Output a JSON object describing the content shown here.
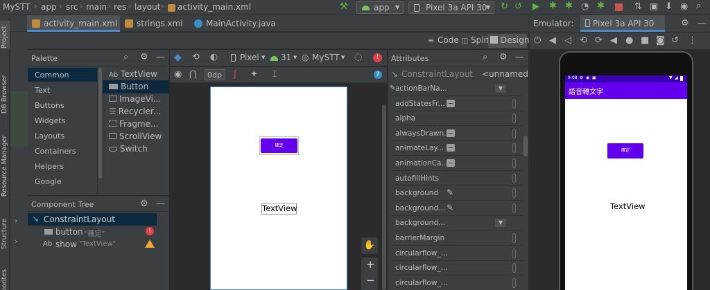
{
  "breadcrumb": {
    "items": [
      "MySTT",
      "app",
      "src",
      "main",
      "res",
      "layout",
      "activity_main.xml"
    ]
  },
  "toolbar": {
    "run_config": "app",
    "device": "Pixel 3a API 30"
  },
  "editor_tabs": [
    {
      "label": "activity_main.xml"
    },
    {
      "label": "strings.xml"
    },
    {
      "label": "MainActivity.java"
    }
  ],
  "emulator": {
    "label": "Emulator:",
    "device_tab": "Pixel 3a API 30",
    "status_time": "9:08",
    "app_title": "語音轉文字",
    "button_text": "確定",
    "textview_text": "TextView"
  },
  "left_strip": {
    "project": "Project",
    "db_browser": "DB Browser",
    "resource_manager": "Resource Manager",
    "structure": "Structure",
    "favorites": "Favorites"
  },
  "view_modes": {
    "code": "Code",
    "split": "Split",
    "design": "Design"
  },
  "palette": {
    "title": "Palette",
    "categories": [
      "Common",
      "Text",
      "Buttons",
      "Widgets",
      "Layouts",
      "Containers",
      "Helpers",
      "Google"
    ],
    "items": [
      {
        "prefix": "Ab",
        "label": "TextView"
      },
      {
        "prefix": "",
        "label": "Button"
      },
      {
        "prefix": "",
        "label": "ImageVi..."
      },
      {
        "prefix": "",
        "label": "Recycler..."
      },
      {
        "prefix": "",
        "label": "Fragme..."
      },
      {
        "prefix": "",
        "label": "ScrollView"
      },
      {
        "prefix": "",
        "label": "Switch"
      }
    ]
  },
  "design_toolbar": {
    "device": "Pixel",
    "api": "31",
    "theme": "MySTT",
    "margin": "0dp"
  },
  "canvas": {
    "button_text": "確定",
    "textview_text": "TextView"
  },
  "zoom": {
    "plus": "+",
    "minus": "−"
  },
  "component_tree": {
    "title": "Component Tree",
    "root": "ConstraintLayout",
    "nodes": [
      {
        "name": "button",
        "value": "\"確定\""
      },
      {
        "prefix": "Ab",
        "name": "show",
        "value": "\"TextView\""
      }
    ]
  },
  "attributes": {
    "title": "Attributes",
    "component": "ConstraintLayout",
    "id": "<unnamed>",
    "rows": [
      {
        "name": "actionBarNa...",
        "kind": "dropdown"
      },
      {
        "name": "addStatesFr...",
        "kind": "bool"
      },
      {
        "name": "alpha",
        "kind": "text"
      },
      {
        "name": "alwaysDrawn...",
        "kind": "bool"
      },
      {
        "name": "animateLay...",
        "kind": "bool"
      },
      {
        "name": "animationCa...",
        "kind": "bool"
      },
      {
        "name": "autofillHints",
        "kind": "text"
      },
      {
        "name": "background",
        "kind": "picker"
      },
      {
        "name": "background...",
        "kind": "picker"
      },
      {
        "name": "background...",
        "kind": "dropdown"
      },
      {
        "name": "barrierMargin",
        "kind": "text"
      },
      {
        "name": "circularflow_...",
        "kind": "text"
      },
      {
        "name": "circularflow_...",
        "kind": "text"
      },
      {
        "name": "circularflow_...",
        "kind": "text"
      }
    ]
  },
  "colors": {
    "accent": "#6200ee",
    "selection": "#0d293e",
    "ide_bg": "#2b2b2b",
    "panel_bg": "#3c3f41",
    "error": "#e0404a",
    "warning": "#f0a732"
  }
}
